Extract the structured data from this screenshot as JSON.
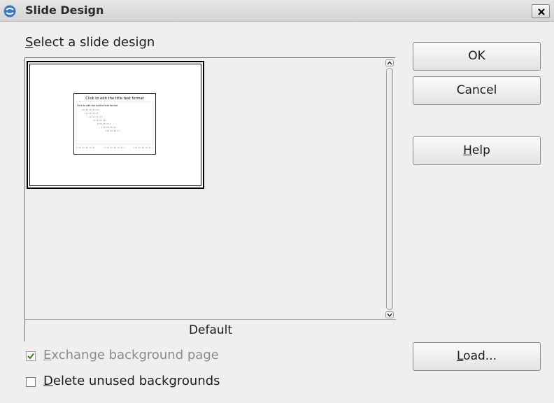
{
  "window": {
    "title": "Slide Design",
    "app_icon": "office-logo-icon",
    "close_icon": "close-icon"
  },
  "design_list": {
    "label_prefix": "",
    "label_mnemonic": "S",
    "label_rest": "elect a slide design",
    "items": [
      {
        "name": "Default",
        "thumbnail_title": "Click to edit the title text format",
        "thumbnail_outline": "Click to edit the outline text format",
        "selected": true
      }
    ]
  },
  "buttons": {
    "ok": "OK",
    "cancel": "Cancel",
    "help_mnemonic": "H",
    "help_rest": "elp",
    "load_mnemonic": "L",
    "load_rest": "oad..."
  },
  "options": {
    "exchange_background": {
      "mnemonic": "E",
      "rest": "xchange background page",
      "checked": true,
      "enabled": false
    },
    "delete_unused": {
      "mnemonic": "D",
      "rest": "elete unused backgrounds",
      "checked": false,
      "enabled": true
    }
  }
}
